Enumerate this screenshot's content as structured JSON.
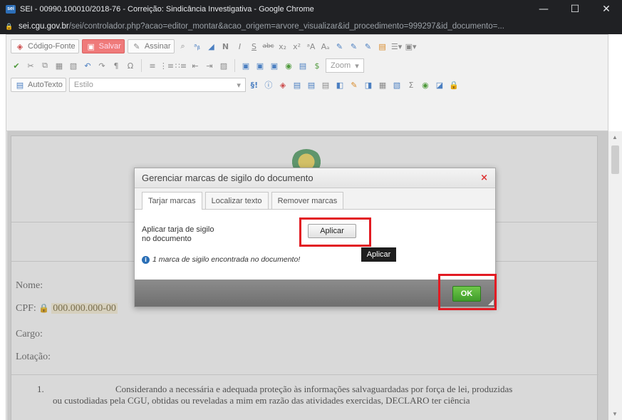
{
  "window": {
    "favicon_text": "sei",
    "title": "SEI - 00990.100010/2018-76 - Correição: Sindicância Investigativa - Google Chrome",
    "controls": {
      "minimize": "—",
      "maximize": "☐",
      "close": "✕"
    }
  },
  "address": {
    "host": "sei.cgu.gov.br",
    "path": "/sei/controlador.php?acao=editor_montar&acao_origem=arvore_visualizar&id_procedimento=999297&id_documento=..."
  },
  "toolbar": {
    "codigo_fonte": "Código-Fonte",
    "salvar": "Salvar",
    "assinar": "Assinar",
    "zoom": "Zoom",
    "autotexto": "AutoTexto",
    "estilo": "Estilo"
  },
  "document": {
    "nome_label": "Nome:",
    "cpf_label": "CPF:",
    "cpf_value": "000.000.000-00",
    "cargo_label": "Cargo:",
    "lotacao_label": "Lotação:",
    "item_number": "1.",
    "para_line1": "Considerando a necessária e adequada proteção às informações salvaguardadas por força de lei, produzidas",
    "para_line2": "ou custodiadas pela CGU, obtidas ou reveladas a mim em razão das atividades exercidas, DECLARO ter ciência"
  },
  "dialog": {
    "title": "Gerenciar marcas de sigilo do documento",
    "close": "×",
    "tabs": [
      {
        "label": "Tarjar marcas",
        "active": true
      },
      {
        "label": "Localizar texto",
        "active": false
      },
      {
        "label": "Remover marcas",
        "active": false
      }
    ],
    "apply_label_line1": "Aplicar tarja de sigilo",
    "apply_label_line2": "no documento",
    "apply_button": "Aplicar",
    "info_text": "1 marca de sigilo encontrada no documento!",
    "ok_button": "OK"
  },
  "tooltip": {
    "text": "Aplicar"
  },
  "colors": {
    "highlight": "#e21b23",
    "ok_green": "#4caf34",
    "chrome_dark": "#202124"
  }
}
